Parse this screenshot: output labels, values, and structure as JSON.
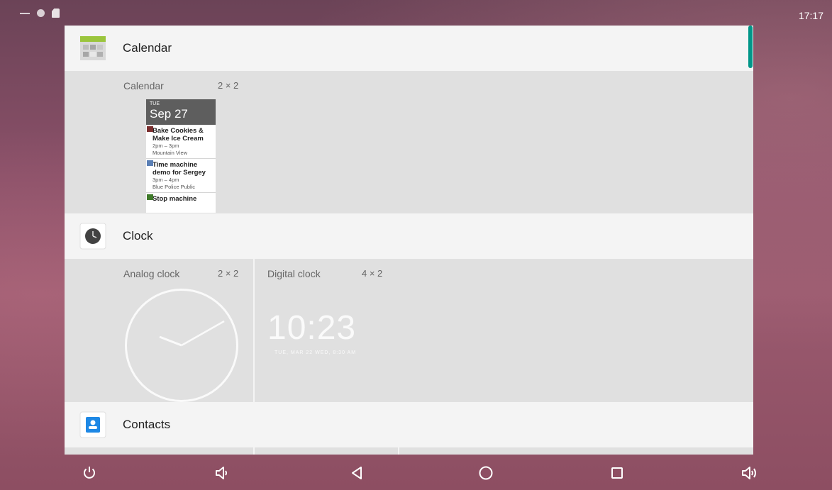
{
  "status_bar": {
    "time": "17:17",
    "icons": [
      "minus-icon",
      "circle-notification-icon",
      "sd-card-icon"
    ]
  },
  "apps": [
    {
      "title": "Calendar",
      "icon": "calendar-app-icon",
      "widgets": [
        {
          "name": "Calendar",
          "size": "2 × 2",
          "preview": {
            "day_of_week": "TUE",
            "date": "Sep 27",
            "events": [
              {
                "title": "Bake Cookies &\nMake Ice Cream",
                "time": "2pm – 3pm",
                "place": "Mountain View",
                "color": "#7b2e2e"
              },
              {
                "title": "Time machine\ndemo for Sergey",
                "time": "3pm – 4pm",
                "place": "Blue Police Public",
                "color": "#5a7fb5"
              },
              {
                "title": "Stop machine",
                "time": "",
                "place": "",
                "color": "#3f7a2a"
              }
            ]
          }
        }
      ]
    },
    {
      "title": "Clock",
      "icon": "clock-app-icon",
      "widgets": [
        {
          "name": "Analog clock",
          "size": "2 × 2"
        },
        {
          "name": "Digital clock",
          "size": "4 × 2",
          "time": "10:23",
          "subtitle": "TUE, MAR 22  WED, 8:30 AM"
        }
      ]
    },
    {
      "title": "Contacts",
      "icon": "contacts-app-icon",
      "widgets": []
    }
  ],
  "nav_bar": {
    "buttons": [
      "power-icon",
      "volume-down-icon",
      "back-icon",
      "home-icon",
      "recents-icon",
      "volume-up-icon"
    ]
  },
  "colors": {
    "accent": "#009688",
    "header_bg": "#f4f4f4",
    "row_bg": "#e0e0e0"
  }
}
